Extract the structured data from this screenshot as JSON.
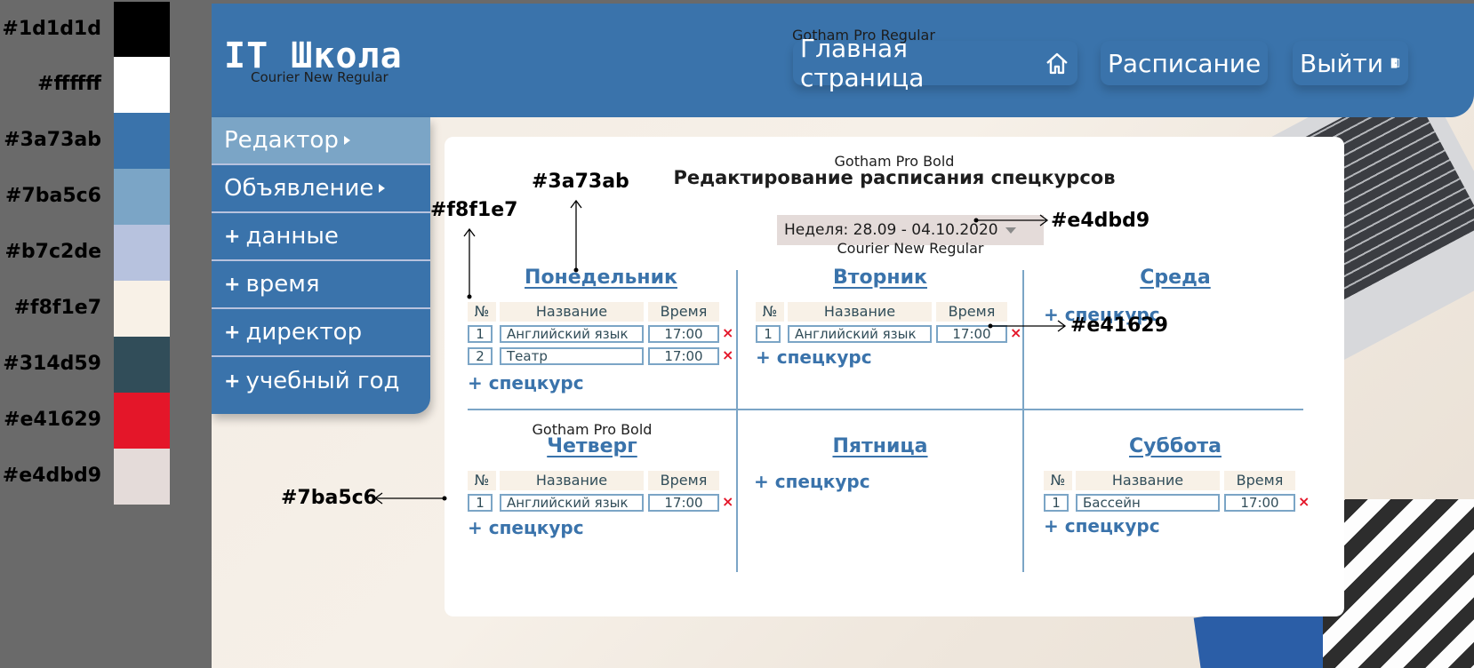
{
  "palette": [
    {
      "hex": "#1d1d1d",
      "color": "#000000"
    },
    {
      "hex": "#ffffff",
      "color": "#ffffff"
    },
    {
      "hex": "#3a73ab",
      "color": "#3a73ab"
    },
    {
      "hex": "#7ba5c6",
      "color": "#7ba5c6"
    },
    {
      "hex": "#b7c2de",
      "color": "#b7c2de"
    },
    {
      "hex": "#f8f1e7",
      "color": "#f8f1e7"
    },
    {
      "hex": "#314d59",
      "color": "#314d59"
    },
    {
      "hex": "#e41629",
      "color": "#e41629"
    },
    {
      "hex": "#e4dbd9",
      "color": "#e4dbd9"
    }
  ],
  "header": {
    "logo": "IT Школа",
    "logo_font_note": "Courier New Regular",
    "nav_font_note": "Gotham Pro Regular",
    "nav": {
      "home": {
        "label": "Главная страница",
        "icon": "home-icon"
      },
      "schedule": {
        "label": "Расписание",
        "icon": "caret-right-icon"
      },
      "logout": {
        "label": "Выйти",
        "icon": "exit-door-icon"
      }
    }
  },
  "sidebar": {
    "items": [
      {
        "label": "Редактор",
        "active": true
      },
      {
        "label": "Объявление"
      },
      {
        "label": "данные"
      },
      {
        "label": "время"
      },
      {
        "label": "директор"
      },
      {
        "label": "учебный год"
      }
    ]
  },
  "main": {
    "title_font_note": "Gotham Pro Bold",
    "title": "Редактирование расписания спецкурсов",
    "week_label": "Неделя:  28.09 - 04.10.2020",
    "week_font_note": "Courier New Regular",
    "day_font_note": "Gotham Pro Bold",
    "columns": {
      "num": "№",
      "name": "Название",
      "time": "Время"
    },
    "add_label": "+ спецкурс",
    "days": {
      "mon": {
        "title": "Понедельник",
        "rows": [
          {
            "num": "1",
            "name": "Английский язык",
            "time": "17:00"
          },
          {
            "num": "2",
            "name": "Театр",
            "time": "17:00"
          }
        ]
      },
      "tue": {
        "title": "Вторник",
        "rows": [
          {
            "num": "1",
            "name": "Английский язык",
            "time": "17:00"
          }
        ]
      },
      "wed": {
        "title": "Среда"
      },
      "thu": {
        "title": "Четверг",
        "rows": [
          {
            "num": "1",
            "name": "Английский язык",
            "time": "17:00"
          }
        ]
      },
      "fri": {
        "title": "Пятница"
      },
      "sat": {
        "title": "Суббота",
        "rows": [
          {
            "num": "1",
            "name": "Бассейн",
            "time": "17:00"
          }
        ]
      }
    },
    "delete_mark": "×"
  },
  "annotations": {
    "a1": "#3a73ab",
    "a2": "#f8f1e7",
    "a3": "#e4dbd9",
    "a4": "#e41629",
    "a5": "#7ba5c6"
  },
  "colors": {
    "accent": "#3a73ab",
    "accent_light": "#7ba5c6",
    "delete": "#e41629",
    "text": "#1d1d1d"
  }
}
